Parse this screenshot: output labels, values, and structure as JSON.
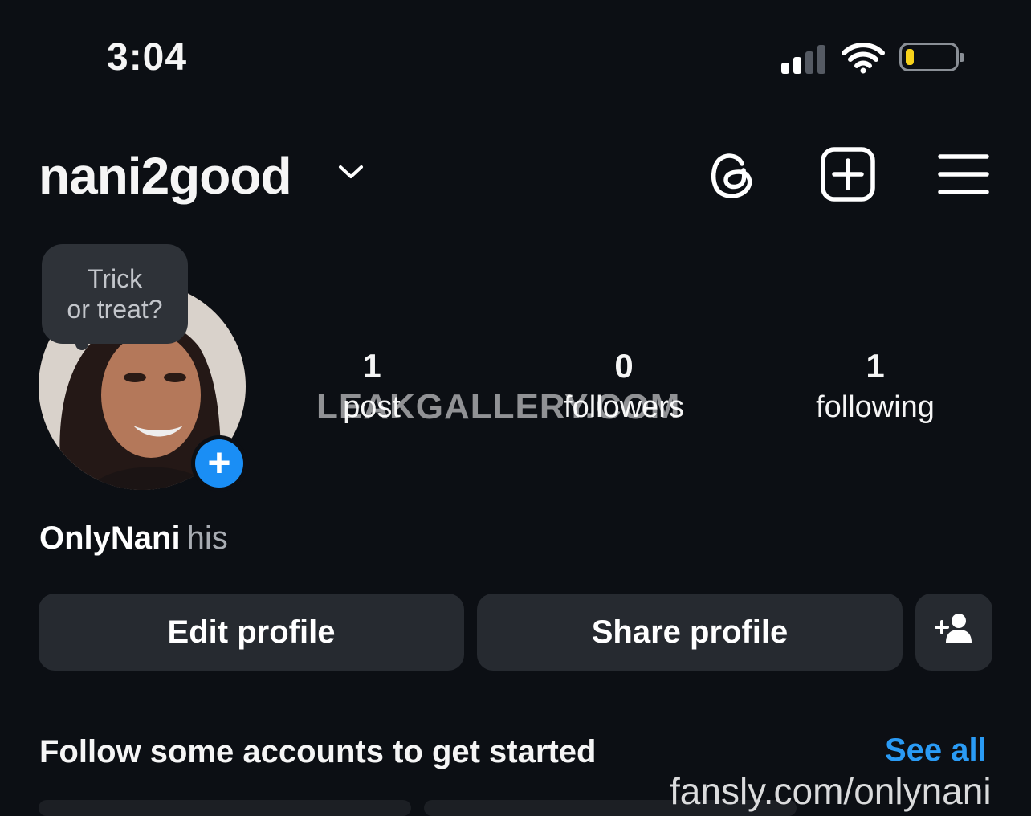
{
  "status_bar": {
    "time": "3:04",
    "signal_icon": "cellular-signal-icon",
    "wifi_icon": "wifi-icon",
    "battery_icon": "battery-low-icon",
    "battery_level": 0.1,
    "battery_color": "#f7d21b"
  },
  "header": {
    "username": "nani2good",
    "dropdown_icon": "chevron-down-icon",
    "threads_icon": "threads-icon",
    "create_icon": "plus-square-icon",
    "menu_icon": "hamburger-menu-icon"
  },
  "profile": {
    "note_line1": "Trick",
    "note_line2": "or treat?",
    "add_story_icon": "plus-icon",
    "stats": [
      {
        "value": "1",
        "label": "post"
      },
      {
        "value": "0",
        "label": "followers"
      },
      {
        "value": "1",
        "label": "following"
      }
    ],
    "display_name": "OnlyNani",
    "pronouns": "his"
  },
  "actions": {
    "edit_label": "Edit profile",
    "share_label": "Share profile",
    "discover_icon": "add-person-icon"
  },
  "suggestions": {
    "title": "Follow some accounts to get started",
    "see_all": "See all"
  },
  "watermarks": {
    "center": "LEAKGALLERY.COM",
    "bottom": "fansly.com/onlynani"
  },
  "colors": {
    "background": "#0c0f14",
    "button": "#262a30",
    "accent": "#2a9bf5",
    "add_badge": "#1a8ef5"
  }
}
